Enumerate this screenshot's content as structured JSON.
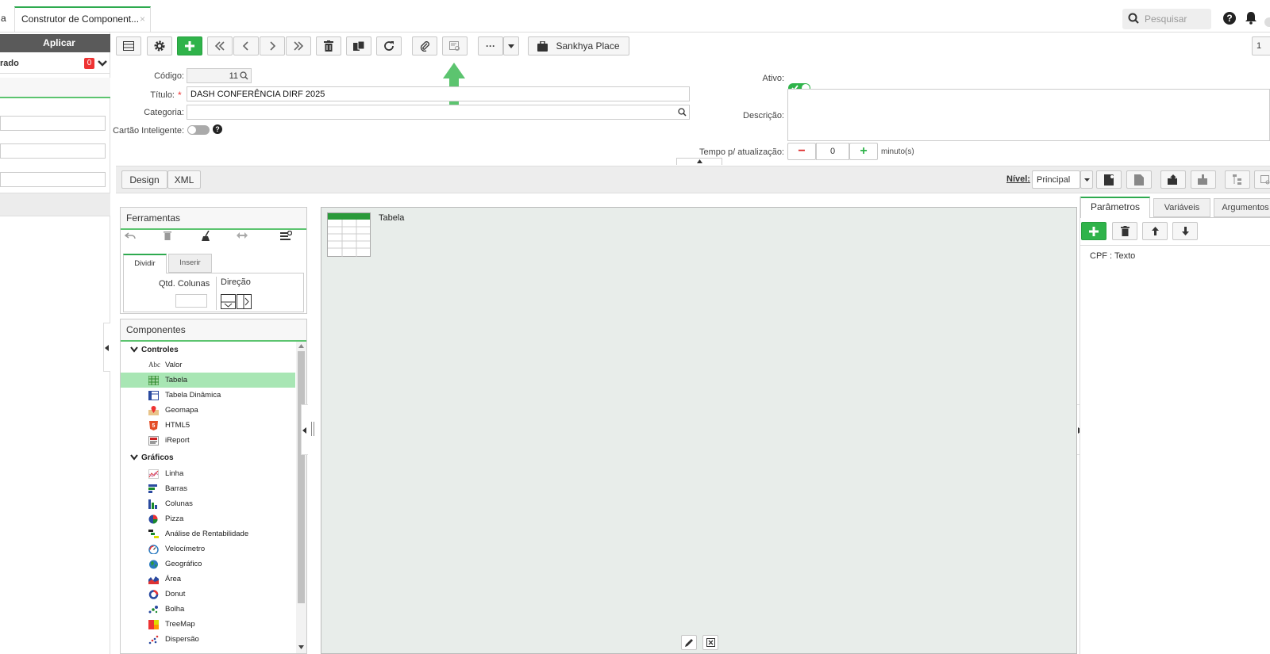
{
  "topbar": {
    "tab_fragment": "a",
    "tab_title": "Construtor de Component...",
    "tab_close": "×",
    "search_placeholder": "Pesquisar"
  },
  "left_panel": {
    "apply_label": "Aplicar",
    "filter_label": "rado",
    "filter_badge": "0"
  },
  "toolbar": {
    "place_label": "Sankhya Place",
    "more_label": "···",
    "page_fragment": "1"
  },
  "form": {
    "codigo_label": "Código:",
    "codigo_value": "11",
    "titulo_label": "Título:",
    "required_mark": "*",
    "titulo_value": "DASH CONFERÊNCIA DIRF 2025",
    "categoria_label": "Categoria:",
    "cartao_label": "Cartão Inteligente:",
    "ativo_label": "Ativo:",
    "descricao_label": "Descrição:",
    "tempo_label": "Tempo p/ atualização:",
    "tempo_value": "0",
    "tempo_unit": "minuto(s)",
    "minus": "−",
    "plus": "+"
  },
  "designbar": {
    "design_label": "Design",
    "xml_label": "XML",
    "nivel_label": "Nível:",
    "nivel_value": "Principal"
  },
  "ferramentas": {
    "title": "Ferramentas",
    "tab_dividir": "Dividir",
    "tab_inserir": "Inserir",
    "qtd_label": "Qtd. Colunas",
    "direcao_label": "Direção"
  },
  "componentes": {
    "title": "Componentes",
    "controles_label": "Controles",
    "controles": [
      "Valor",
      "Tabela",
      "Tabela Dinâmica",
      "Geomapa",
      "HTML5",
      "iReport"
    ],
    "graficos_label": "Gráficos",
    "graficos": [
      "Linha",
      "Barras",
      "Colunas",
      "Pizza",
      "Análise de Rentabilidade",
      "Velocímetro",
      "Geográfico",
      "Área",
      "Donut",
      "Bolha",
      "TreeMap",
      "Dispersão"
    ],
    "valor_icon_text": "Abc"
  },
  "canvas": {
    "tabela_label": "Tabela"
  },
  "right_panel": {
    "tab_parametros": "Parâmetros",
    "tab_variaveis": "Variáveis",
    "tab_argumentos": "Argumentos",
    "param_item": "CPF : Texto"
  }
}
